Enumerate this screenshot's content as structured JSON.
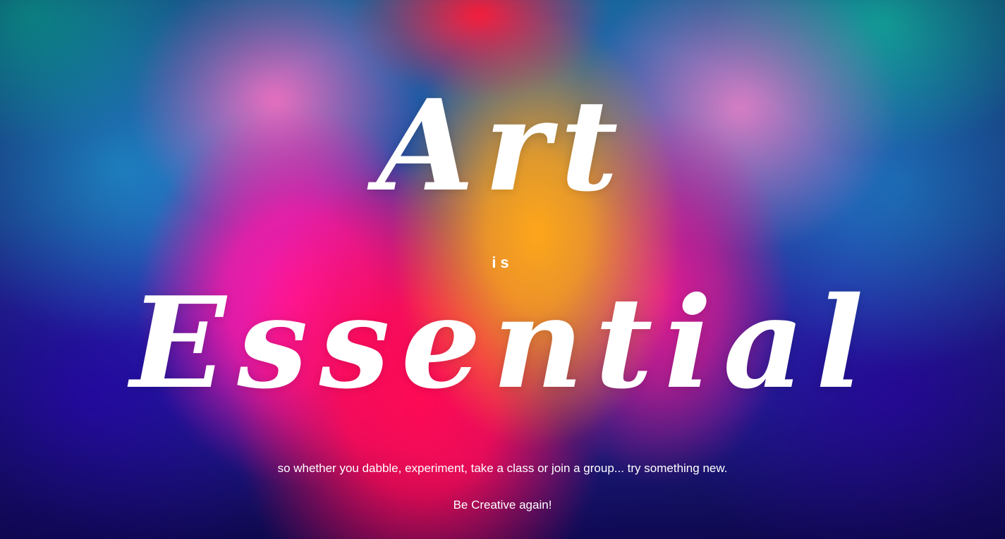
{
  "hero": {
    "title_line1": "Art",
    "connector": "is",
    "title_line2": "Essential",
    "tagline": "so whether you dabble, experiment, take a class or join a group... try something new.",
    "cta": "Be Creative again!"
  },
  "colors": {
    "text": "#ffffff",
    "bg_orange": "#ffa61a",
    "bg_magenta": "#ff1aa8",
    "bg_red": "#ff0a55",
    "bg_teal": "#10b6b0",
    "bg_indigo": "#2a0bb8"
  }
}
